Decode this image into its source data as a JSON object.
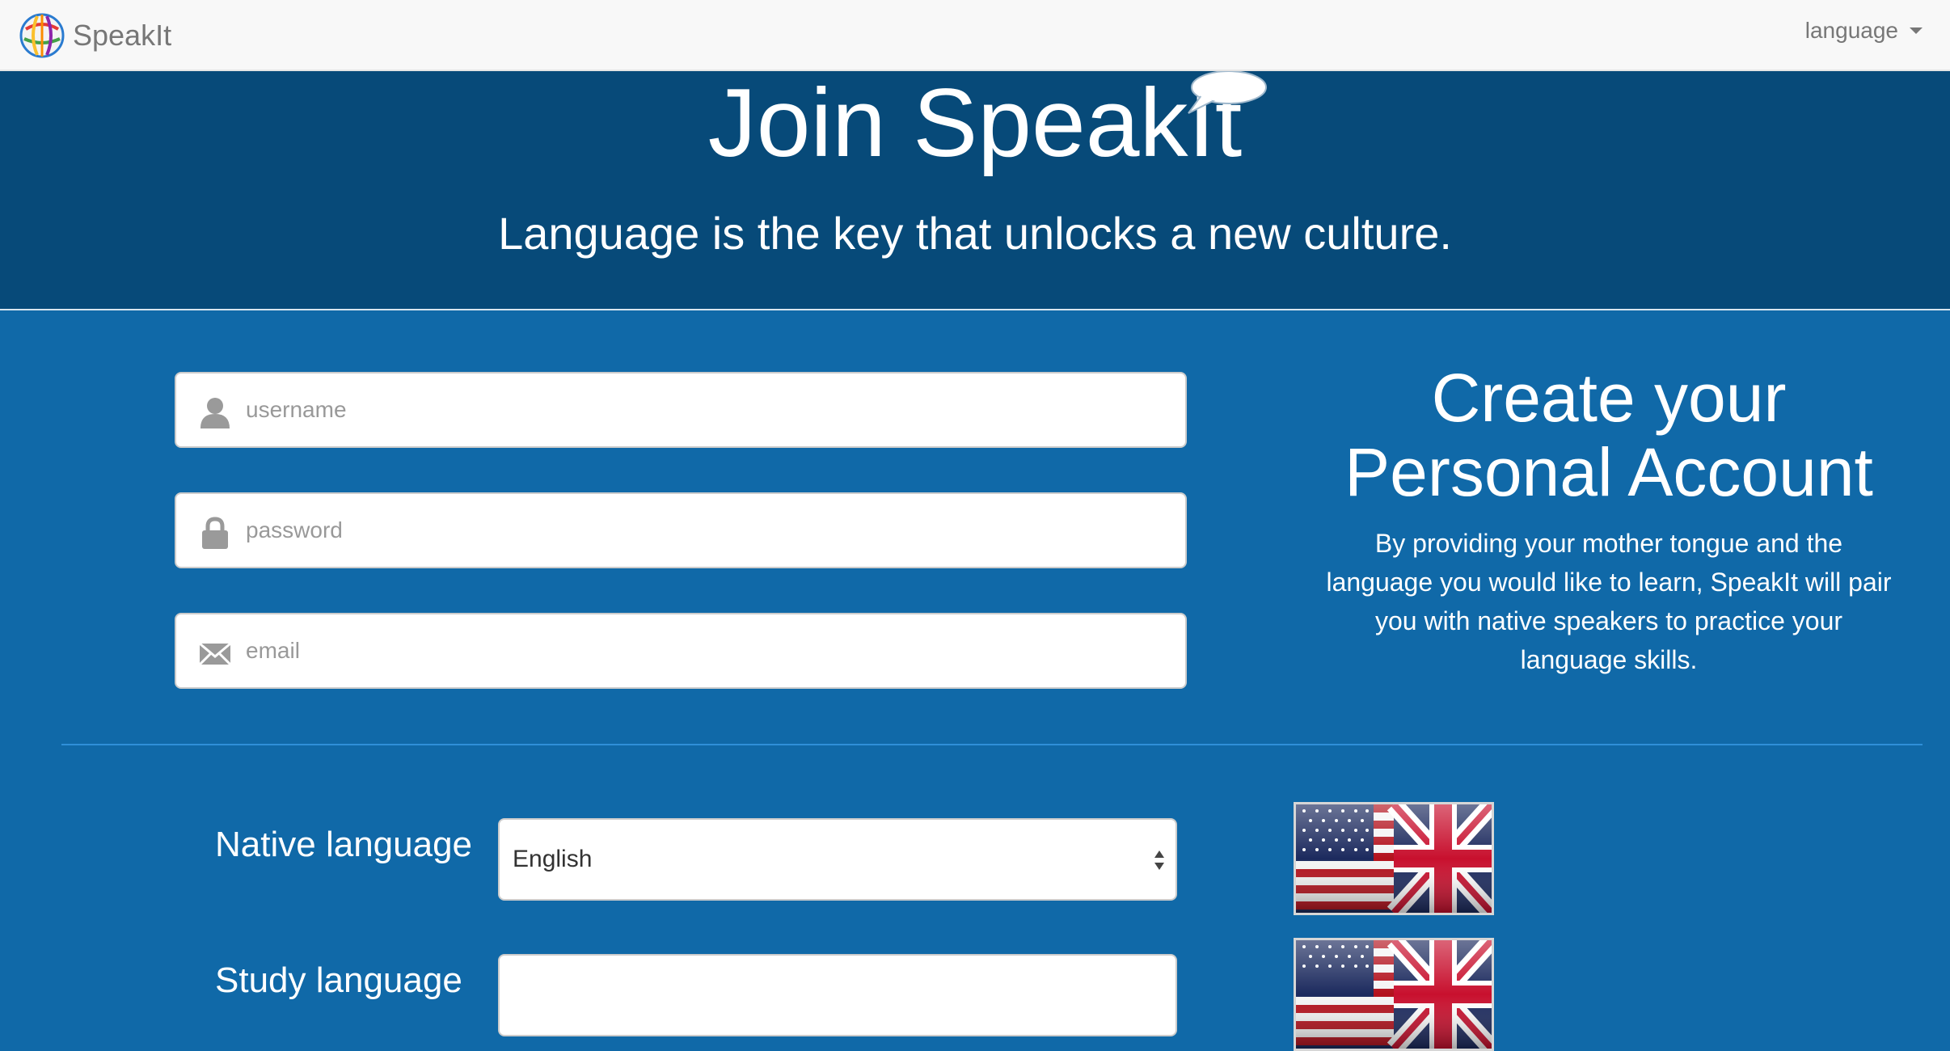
{
  "navbar": {
    "brand": "SpeakIt",
    "language_menu": "language"
  },
  "hero": {
    "title": "Join SpeakIt",
    "tagline": "Language is the key that unlocks a new culture."
  },
  "form": {
    "username_placeholder": "username",
    "password_placeholder": "password",
    "email_placeholder": "email"
  },
  "info": {
    "title_line1": "Create your",
    "title_line2": "Personal Account",
    "description": "By providing your mother tongue and the language you would like to learn, SpeakIt will pair you with native speakers to practice your language skills."
  },
  "languages": {
    "native_label": "Native language",
    "native_value": "English",
    "study_label": "Study language",
    "study_value": ""
  },
  "icons": {
    "logo": "globe-logo-icon",
    "caret": "caret-down-icon",
    "bubble": "speech-bubble-icon",
    "user": "user-icon",
    "lock": "lock-icon",
    "envelope": "envelope-icon",
    "select_arrows": "select-arrows-icon",
    "flag": "us-uk-flag-icon"
  },
  "colors": {
    "navbar_bg": "#f8f8f8",
    "hero_bg": "#074a79",
    "body_bg": "#1069a8",
    "text_light": "#ffffff"
  }
}
